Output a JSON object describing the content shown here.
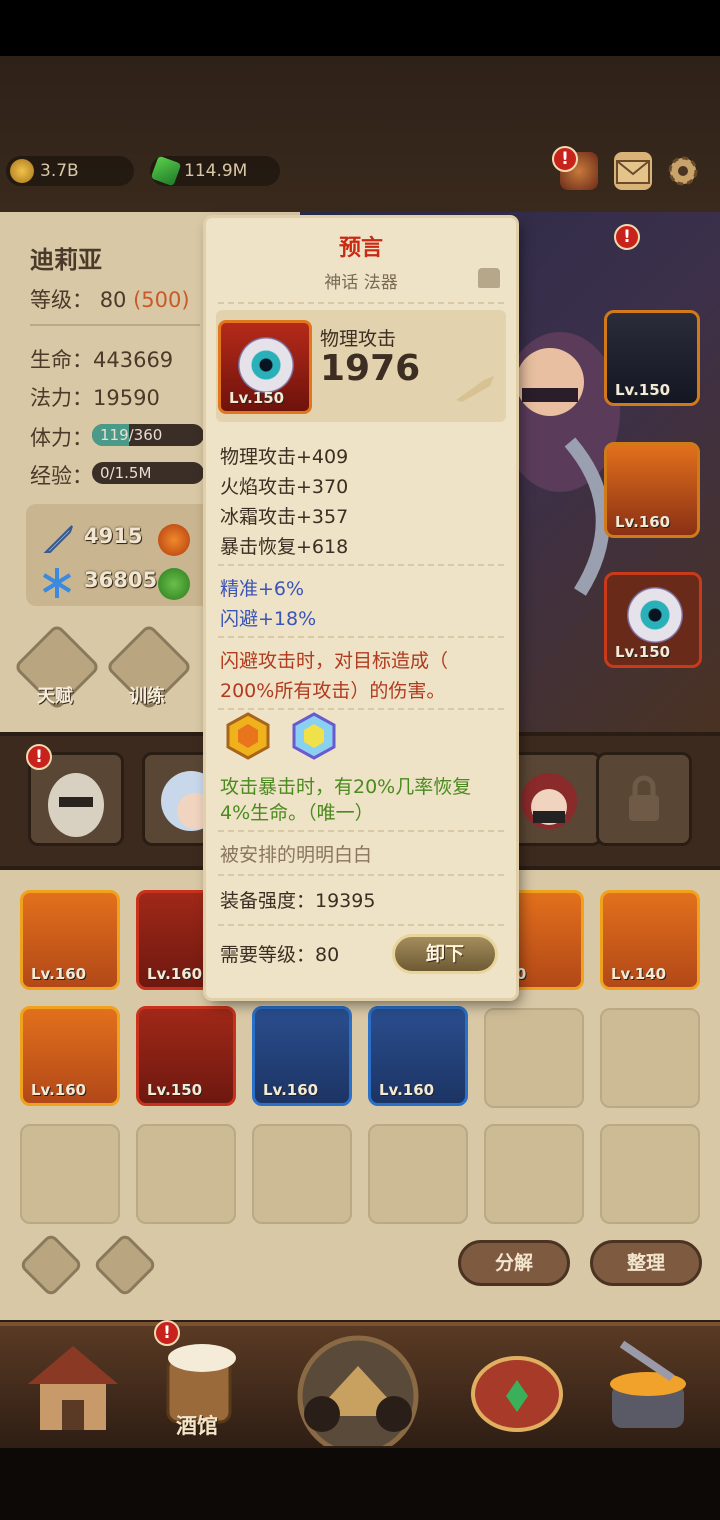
{
  "resources": {
    "gold": "3.7B",
    "gems": "114.9M"
  },
  "character": {
    "name": "迪莉亚",
    "level_label": "等级：",
    "level": "80",
    "level_cap": "(500)",
    "hp_label": "生命：",
    "hp": "443669",
    "mp_label": "法力：",
    "mp": "19590",
    "stamina_label": "体力：",
    "stamina": "119/360",
    "stamina_fill": 0.33,
    "exp_label": "经验：",
    "exp": "0/1.5M",
    "exp_fill": 0.0,
    "atk": "4915",
    "def": "36805",
    "talent_label": "天赋",
    "train_label": "训练"
  },
  "side_equipment": [
    {
      "level": "Lv.150"
    },
    {
      "level": "Lv.160"
    },
    {
      "level": "Lv.150"
    }
  ],
  "inventory": [
    {
      "level": "Lv.160"
    },
    {
      "level": "Lv.160"
    },
    {
      "level": "150"
    },
    {
      "level": "Lv.140"
    },
    {
      "level": "Lv.160"
    },
    {
      "level": "Lv.150"
    },
    {
      "level": "Lv.160"
    },
    {
      "level": "Lv.160"
    }
  ],
  "buttons": {
    "decompose": "分解",
    "sort": "整理"
  },
  "nav": {
    "tavern": "酒馆"
  },
  "tooltip": {
    "title": "预言",
    "subtitle": "神话 法器",
    "item_level": "Lv.150",
    "primary_label": "物理攻击",
    "primary_value": "1976",
    "stats": [
      "物理攻击+409",
      "火焰攻击+370",
      "冰霜攻击+357",
      "暴击恢复+618"
    ],
    "bonus_stats": [
      "精准+6%",
      "闪避+18%"
    ],
    "effect_line1": "闪避攻击时，对目标造成（",
    "effect_line2": "200%所有攻击）的伤害。",
    "gem_effect_line1": "攻击暴击时，有20%几率恢复",
    "gem_effect_line2": "4%生命。（唯一）",
    "flavor": "被安排的明明白白",
    "power": "装备强度：19395",
    "req_level": "需要等级：80",
    "unequip": "卸下"
  },
  "colors": {
    "mythic_title": "#c82a14",
    "blue_stat": "#3a54b8",
    "effect_red": "#b23a1e",
    "effect_green": "#4a8a1e"
  }
}
